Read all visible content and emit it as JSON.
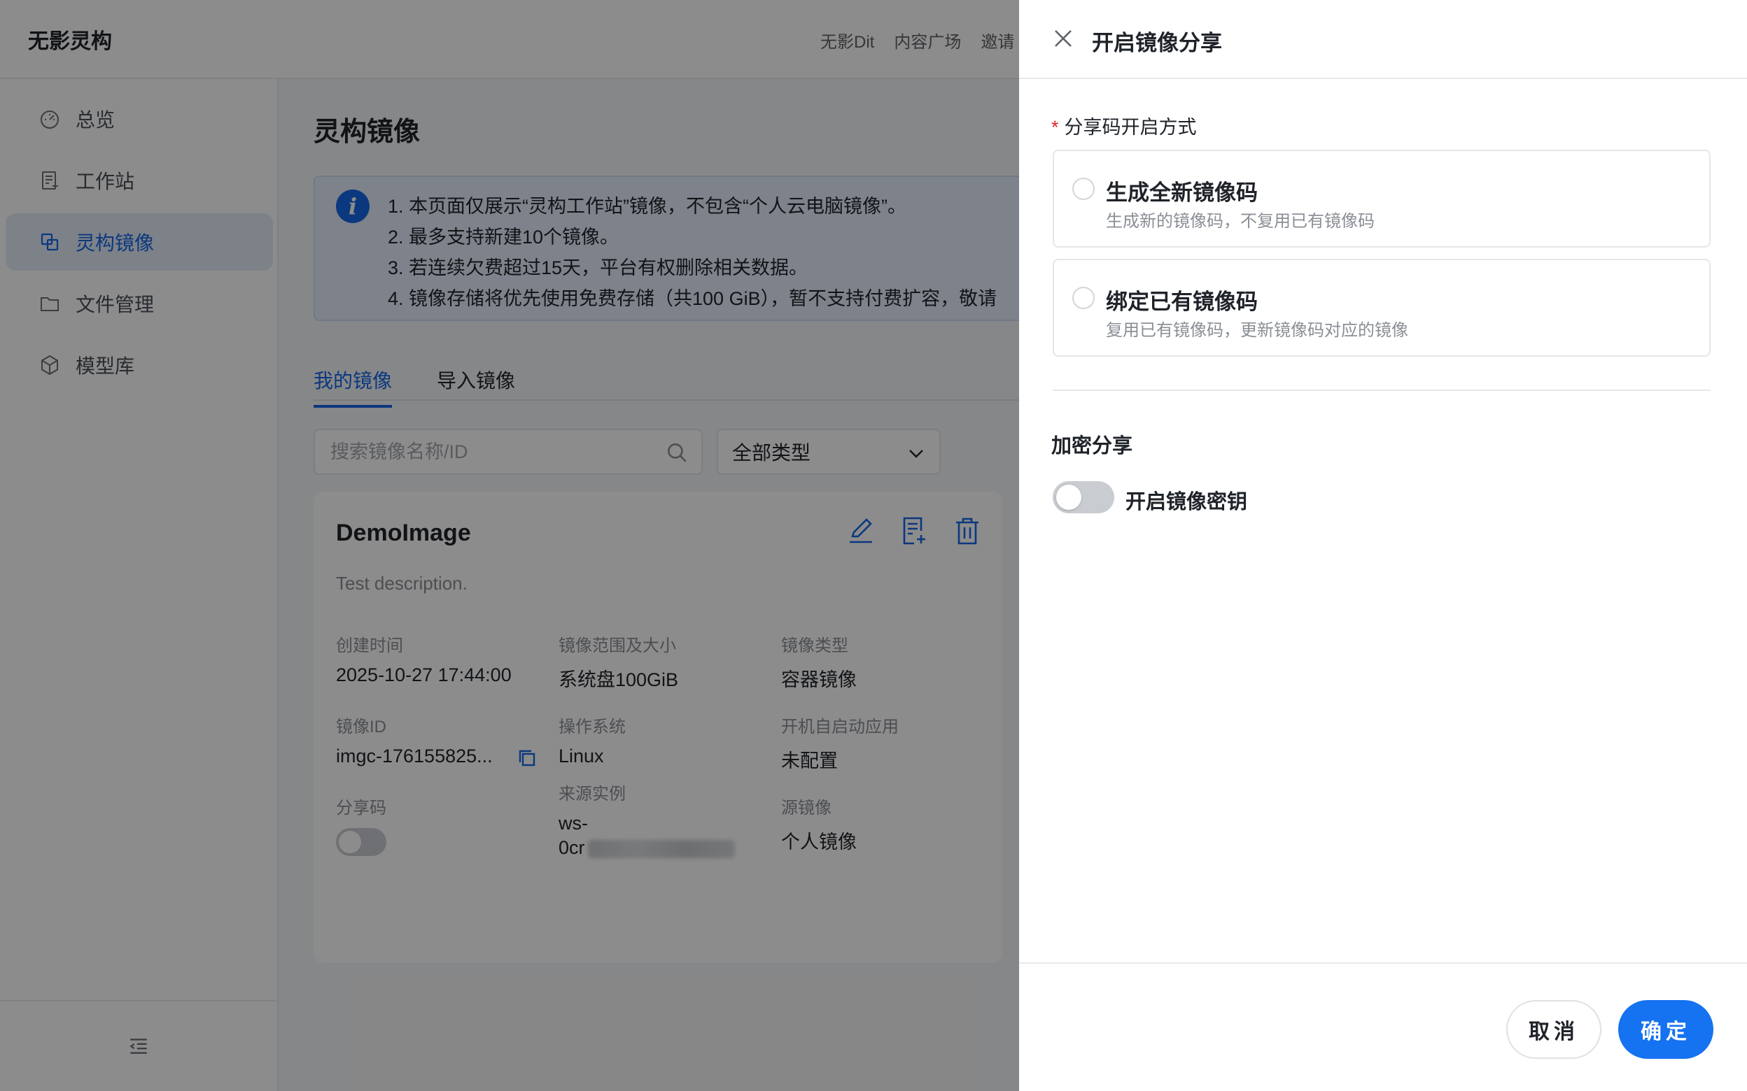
{
  "app": {
    "brand": "无影灵构"
  },
  "topnav": [
    "无影Dit",
    "内容广场",
    "邀请"
  ],
  "sidebar": {
    "items": [
      {
        "label": "总览",
        "icon": "dashboard-icon"
      },
      {
        "label": "工作站",
        "icon": "workstation-icon"
      },
      {
        "label": "灵构镜像",
        "icon": "image-icon",
        "active": true
      },
      {
        "label": "文件管理",
        "icon": "folder-icon"
      },
      {
        "label": "模型库",
        "icon": "cube-icon"
      }
    ],
    "collapse_icon": "collapse-menu-icon"
  },
  "main": {
    "title": "灵构镜像",
    "notice": {
      "lines": [
        "1. 本页面仅展示“灵构工作站”镜像，不包含“个人云电脑镜像”。",
        "2. 最多支持新建10个镜像。",
        "3. 若连续欠费超过15天，平台有权删除相关数据。",
        "4. 镜像存储将优先使用免费存储（共100 GiB），暂不支持付费扩容，敬请"
      ]
    },
    "tabs": [
      "我的镜像",
      "导入镜像"
    ],
    "search": {
      "placeholder": "搜索镜像名称/ID",
      "value": ""
    },
    "type_select": {
      "selected": "全部类型"
    },
    "card": {
      "name": "DemoImage",
      "description": "Test description.",
      "fields": {
        "created_label": "创建时间",
        "created_value": "2025-10-27 17:44:00",
        "scope_label": "镜像范围及大小",
        "scope_value": "系统盘100GiB",
        "type_label": "镜像类型",
        "type_value": "容器镜像",
        "id_label": "镜像ID",
        "id_value": "imgc-176155825...",
        "os_label": "操作系统",
        "os_value": "Linux",
        "autostart_label": "开机自启动应用",
        "autostart_value": "未配置",
        "share_label": "分享码",
        "source_instance_label": "来源实例",
        "source_instance_line1": "ws-",
        "source_instance_line2": "0cr",
        "source_image_label": "源镜像",
        "source_image_value": "个人镜像"
      }
    }
  },
  "drawer": {
    "title": "开启镜像分享",
    "required_mark": "*",
    "method_label": "分享码开启方式",
    "options": [
      {
        "title": "生成全新镜像码",
        "desc": "生成新的镜像码，不复用已有镜像码"
      },
      {
        "title": "绑定已有镜像码",
        "desc": "复用已有镜像码，更新镜像码对应的镜像"
      }
    ],
    "encrypt_title": "加密分享",
    "encrypt_toggle_label": "开启镜像密钥",
    "cancel_label": "取消",
    "confirm_label": "确定"
  },
  "colors": {
    "accent": "#1467e6",
    "primary_button": "#1572f0",
    "required": "#e0282e"
  }
}
